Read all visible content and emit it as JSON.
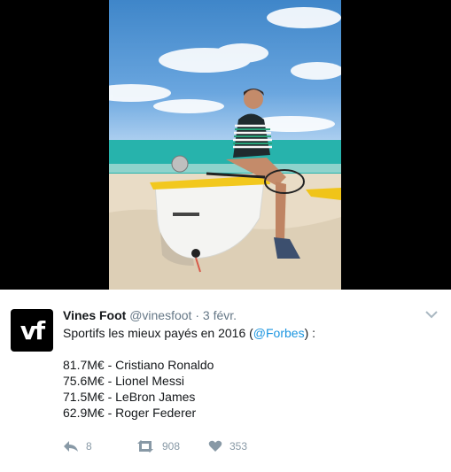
{
  "tweet": {
    "avatar_text": "vf",
    "name": "Vines Foot",
    "handle": "@vinesfoot",
    "separator": "·",
    "time": "3 févr.",
    "text_intro": "Sportifs les mieux payés en 2016 (",
    "mention": "@Forbes",
    "text_outro": ") :",
    "list": [
      "81.7M€ - Cristiano Ronaldo",
      "75.6M€ - Lionel Messi",
      "71.5M€ - LeBron James",
      "62.9M€ - Roger Federer"
    ],
    "reply_count": "8",
    "retweet_count": "908",
    "like_count": "353"
  },
  "icons": {
    "reply": "reply-icon",
    "retweet": "retweet-icon",
    "like": "heart-icon",
    "caret": "chevron-down-icon"
  },
  "colors": {
    "mention": "#1b95e0",
    "muted": "#657786",
    "action": "#8899a6"
  }
}
